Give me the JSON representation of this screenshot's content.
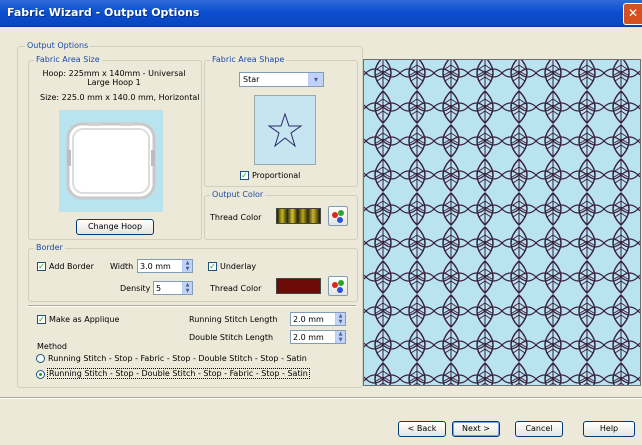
{
  "window": {
    "title": "Fabric Wizard - Output Options",
    "close_glyph": "✕"
  },
  "output_options": {
    "legend": "Output Options"
  },
  "fabric_area_size": {
    "legend": "Fabric Area Size",
    "hoop": "Hoop: 225mm x 140mm - Universal Large Hoop 1",
    "size": "Size: 225.0 mm x 140.0 mm, Horizontal",
    "change_hoop": "Change Hoop"
  },
  "fabric_area_shape": {
    "legend": "Fabric Area Shape",
    "shape": "Star",
    "proportional": "Proportional",
    "proportional_checked": true
  },
  "output_color": {
    "legend": "Output Color",
    "thread_color_label": "Thread Color"
  },
  "border": {
    "legend": "Border",
    "add_border": "Add Border",
    "add_border_checked": true,
    "width_label": "Width",
    "width_value": "3.0 mm",
    "density_label": "Density",
    "density_value": "5",
    "underlay": "Underlay",
    "underlay_checked": true,
    "thread_color_label": "Thread Color",
    "thread_color": "#6b0b08"
  },
  "applique": {
    "make_as_applique": "Make as Applique",
    "make_as_applique_checked": true,
    "running_stitch_length_label": "Running Stitch Length",
    "running_stitch_length": "2.0 mm",
    "double_stitch_length_label": "Double Stitch Length",
    "double_stitch_length": "2.0 mm",
    "method_label": "Method",
    "method_options": [
      "Running Stitch - Stop - Fabric - Stop - Double Stitch - Stop - Satin",
      "Running Stitch - Stop - Double Stitch - Stop - Fabric - Stop - Satin"
    ],
    "selected_method": 1
  },
  "buttons": {
    "back": "< Back",
    "next": "Next >",
    "cancel": "Cancel",
    "help": "Help"
  },
  "colors": {
    "preview_fabric": "#b9e3ef",
    "preview_stitch": "#3a1f3e",
    "accent": "#0c4fd0"
  }
}
